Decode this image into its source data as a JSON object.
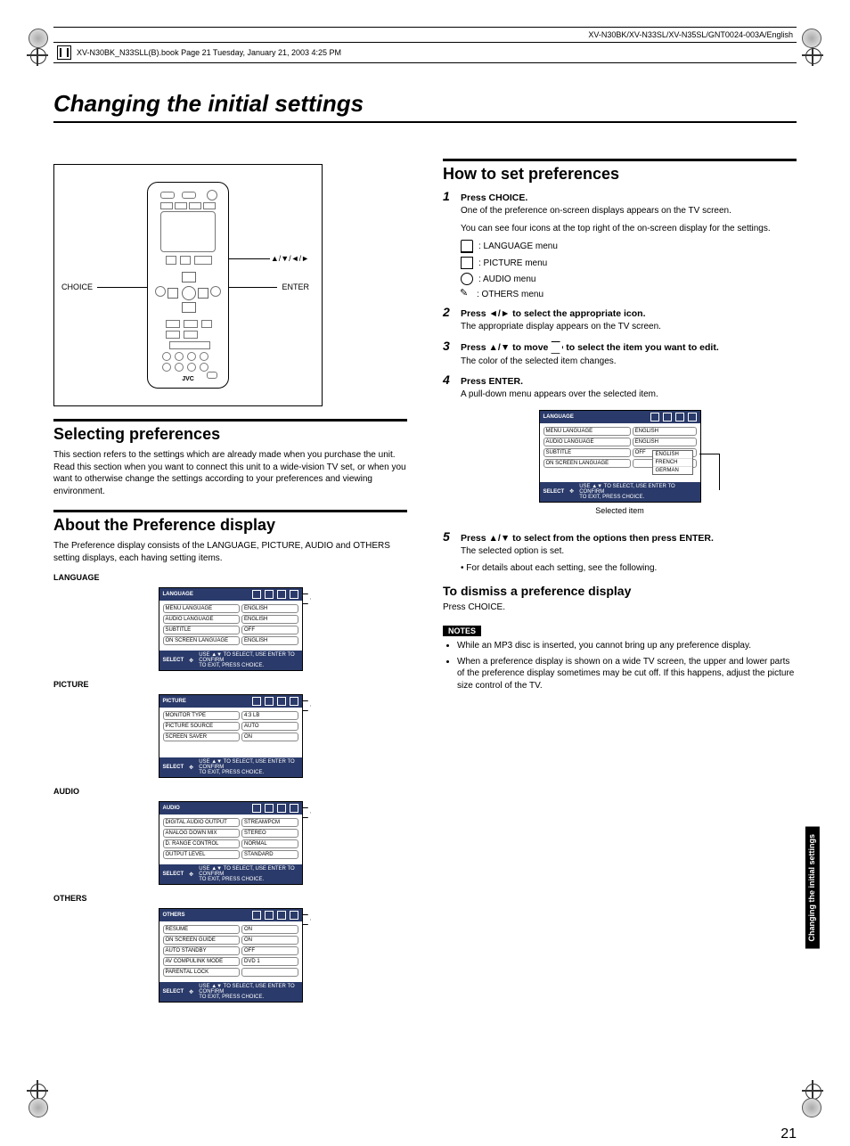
{
  "header": {
    "path": "XV-N30BK/XV-N33SL/XV-N35SL/GNT0024-003A/English",
    "book_line": "XV-N30BK_N33SLL(B).book  Page 21  Tuesday, January 21, 2003  4:25 PM"
  },
  "title": "Changing the initial settings",
  "remote": {
    "choice": "CHOICE",
    "enter": "ENTER",
    "arrows": "▲/▼/◄/►",
    "brand": "JVC"
  },
  "left": {
    "sec1_title": "Selecting preferences",
    "sec1_body": "This section refers to the settings which are already made when you purchase the unit. Read this section when you want to connect this unit to a wide-vision TV set, or when you want to otherwise change the settings according to your preferences and viewing environment.",
    "sec2_title": "About the Preference display",
    "sec2_body": "The Preference display consists of the LANGUAGE, PICTURE, AUDIO and OTHERS setting displays, each having setting items.",
    "labels": {
      "language": "LANGUAGE",
      "picture": "PICTURE",
      "audio": "AUDIO",
      "others": "OTHERS"
    },
    "osd_footer_key": "SELECT",
    "osd_footer_key2": "ENTER",
    "osd_footer_hint1": "USE ▲▼ TO SELECT, USE ENTER TO CONFIRM",
    "osd_footer_hint2": "TO EXIT, PRESS CHOICE.",
    "language_osd": {
      "title": "LANGUAGE",
      "rows": [
        {
          "k": "MENU LANGUAGE",
          "v": "ENGLISH"
        },
        {
          "k": "AUDIO LANGUAGE",
          "v": "ENGLISH"
        },
        {
          "k": "SUBTITLE",
          "v": "OFF"
        },
        {
          "k": "ON SCREEN LANGUAGE",
          "v": "ENGLISH"
        }
      ]
    },
    "picture_osd": {
      "title": "PICTURE",
      "rows": [
        {
          "k": "MONITOR TYPE",
          "v": "4:3 LB"
        },
        {
          "k": "PICTURE SOURCE",
          "v": "AUTO"
        },
        {
          "k": "SCREEN SAVER",
          "v": "ON"
        }
      ]
    },
    "audio_osd": {
      "title": "AUDIO",
      "rows": [
        {
          "k": "DIGITAL AUDIO OUTPUT",
          "v": "STREAM/PCM"
        },
        {
          "k": "ANALOG DOWN MIX",
          "v": "STEREO"
        },
        {
          "k": "D. RANGE CONTROL",
          "v": "NORMAL"
        },
        {
          "k": "OUTPUT LEVEL",
          "v": "STANDARD"
        }
      ]
    },
    "others_osd": {
      "title": "OTHERS",
      "rows": [
        {
          "k": "RESUME",
          "v": "ON"
        },
        {
          "k": "ON SCREEN GUIDE",
          "v": "ON"
        },
        {
          "k": "AUTO STANDBY",
          "v": "OFF"
        },
        {
          "k": "AV COMPULINK MODE",
          "v": "DVD 1"
        },
        {
          "k": "PARENTAL LOCK",
          "v": ""
        }
      ]
    }
  },
  "right": {
    "sec_title": "How to set preferences",
    "steps": {
      "s1_head": "Press CHOICE.",
      "s1_body1": "One of the preference on-screen displays appears on the TV screen.",
      "s1_body2": "You can see four icons at the top right of the on-screen display for the settings.",
      "menus": {
        "lang": ": LANGUAGE menu",
        "pic": ": PICTURE menu",
        "audio": ": AUDIO menu",
        "others": ": OTHERS menu"
      },
      "s2_head": "Press ◄/► to select the appropriate icon.",
      "s2_body": "The appropriate display appears on the TV screen.",
      "s3_head_a": "Press ▲/▼ to move ",
      "s3_head_b": " to select the item you want to edit.",
      "s3_body": "The color of the selected item changes.",
      "s4_head": "Press ENTER.",
      "s4_body": "A pull-down menu appears over the selected item.",
      "s5_head": "Press ▲/▼ to select from the options then press ENTER.",
      "s5_body1": "The selected option is set.",
      "s5_body2": "• For details about each setting, see the following."
    },
    "example_osd": {
      "title": "LANGUAGE",
      "rows": [
        {
          "k": "MENU LANGUAGE",
          "v": "ENGLISH"
        },
        {
          "k": "AUDIO LANGUAGE",
          "v": "ENGLISH"
        },
        {
          "k": "SUBTITLE",
          "v": "OFF"
        },
        {
          "k": "ON SCREEN LANGUAGE",
          "v": ""
        }
      ],
      "dropdown": [
        "ENGLISH",
        "FRENCH",
        "GERMAN"
      ],
      "selected_label": "Selected item"
    },
    "dismiss_title": "To dismiss a preference display",
    "dismiss_body": "Press CHOICE.",
    "notes_tag": "NOTES",
    "notes": [
      "While an MP3 disc is inserted, you cannot bring up any preference display.",
      "When a preference display is shown on a wide TV screen, the upper and lower parts of the preference display sometimes may be cut off. If this happens, adjust the picture size control of the TV."
    ]
  },
  "side_tab": "Changing the\ninitial settings",
  "page_number": "21"
}
